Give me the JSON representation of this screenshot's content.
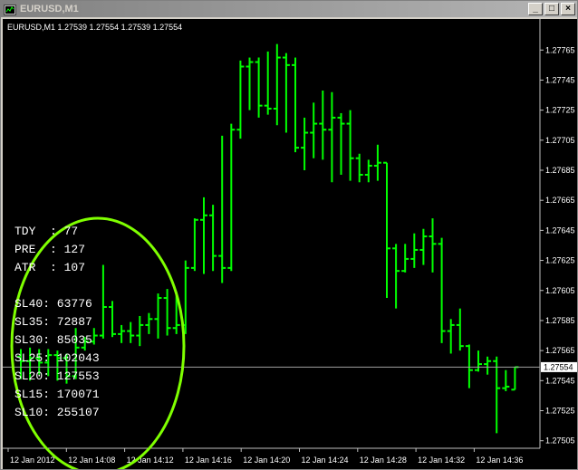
{
  "window": {
    "title": "EURUSD,M1",
    "minimize_glyph": "_",
    "maximize_glyph": "□",
    "close_glyph": "×"
  },
  "chart": {
    "header": "EURUSD,M1  1.27539 1.27554 1.27539 1.27554",
    "current_price_label": "1.27554",
    "colors": {
      "background": "#000000",
      "bars": "#00ff00",
      "axis": "#c0c0c0",
      "ellipse": "#7fff00",
      "text": "#ffffff"
    }
  },
  "chart_data": {
    "type": "ohlc",
    "y_ticks": [
      "1.27765",
      "1.27745",
      "1.27725",
      "1.27705",
      "1.27685",
      "1.27665",
      "1.27645",
      "1.27625",
      "1.27605",
      "1.27585",
      "1.27565",
      "1.27545",
      "1.27525",
      "1.27505"
    ],
    "x_ticks": [
      "12 Jan 2012",
      "12 Jan 14:08",
      "12 Jan 14:12",
      "12 Jan 14:16",
      "12 Jan 14:20",
      "12 Jan 14:24",
      "12 Jan 14:28",
      "12 Jan 14:32",
      "12 Jan 14:36"
    ],
    "ylim": [
      1.275,
      1.27776
    ],
    "current_price": 1.27554,
    "bars": [
      {
        "o": 1.27561,
        "h": 1.27566,
        "l": 1.27546,
        "c": 1.27558
      },
      {
        "o": 1.27558,
        "h": 1.27567,
        "l": 1.27545,
        "c": 1.2756
      },
      {
        "o": 1.2756,
        "h": 1.27566,
        "l": 1.27549,
        "c": 1.27557
      },
      {
        "o": 1.27557,
        "h": 1.27566,
        "l": 1.27548,
        "c": 1.27562
      },
      {
        "o": 1.27562,
        "h": 1.27565,
        "l": 1.27545,
        "c": 1.2756
      },
      {
        "o": 1.2756,
        "h": 1.27563,
        "l": 1.27543,
        "c": 1.27548
      },
      {
        "o": 1.27548,
        "h": 1.2758,
        "l": 1.27546,
        "c": 1.27567
      },
      {
        "o": 1.27567,
        "h": 1.27574,
        "l": 1.27565,
        "c": 1.27571
      },
      {
        "o": 1.27571,
        "h": 1.2758,
        "l": 1.27569,
        "c": 1.27575
      },
      {
        "o": 1.27575,
        "h": 1.27622,
        "l": 1.27573,
        "c": 1.27594
      },
      {
        "o": 1.27594,
        "h": 1.27598,
        "l": 1.27574,
        "c": 1.27576
      },
      {
        "o": 1.27576,
        "h": 1.27582,
        "l": 1.2757,
        "c": 1.27578
      },
      {
        "o": 1.27578,
        "h": 1.27584,
        "l": 1.2757,
        "c": 1.27575
      },
      {
        "o": 1.27575,
        "h": 1.27588,
        "l": 1.27568,
        "c": 1.27582
      },
      {
        "o": 1.27582,
        "h": 1.2759,
        "l": 1.27576,
        "c": 1.27586
      },
      {
        "o": 1.27586,
        "h": 1.27603,
        "l": 1.27573,
        "c": 1.276
      },
      {
        "o": 1.276,
        "h": 1.27606,
        "l": 1.27575,
        "c": 1.2758
      },
      {
        "o": 1.2758,
        "h": 1.27604,
        "l": 1.27576,
        "c": 1.27582
      },
      {
        "o": 1.27582,
        "h": 1.27625,
        "l": 1.27576,
        "c": 1.2762
      },
      {
        "o": 1.2762,
        "h": 1.27653,
        "l": 1.27618,
        "c": 1.27652
      },
      {
        "o": 1.27652,
        "h": 1.27667,
        "l": 1.27616,
        "c": 1.27655
      },
      {
        "o": 1.27655,
        "h": 1.27662,
        "l": 1.27618,
        "c": 1.27628
      },
      {
        "o": 1.27628,
        "h": 1.27708,
        "l": 1.2761,
        "c": 1.2762
      },
      {
        "o": 1.2762,
        "h": 1.27716,
        "l": 1.27618,
        "c": 1.27712
      },
      {
        "o": 1.27712,
        "h": 1.27758,
        "l": 1.27706,
        "c": 1.27754
      },
      {
        "o": 1.27754,
        "h": 1.2776,
        "l": 1.27725,
        "c": 1.27757
      },
      {
        "o": 1.27757,
        "h": 1.2776,
        "l": 1.2772,
        "c": 1.27728
      },
      {
        "o": 1.27728,
        "h": 1.27764,
        "l": 1.27722,
        "c": 1.27726
      },
      {
        "o": 1.27726,
        "h": 1.27769,
        "l": 1.27715,
        "c": 1.2776
      },
      {
        "o": 1.2776,
        "h": 1.27763,
        "l": 1.2771,
        "c": 1.27755
      },
      {
        "o": 1.27755,
        "h": 1.2776,
        "l": 1.27697,
        "c": 1.277
      },
      {
        "o": 1.277,
        "h": 1.2772,
        "l": 1.27685,
        "c": 1.2771
      },
      {
        "o": 1.2771,
        "h": 1.2773,
        "l": 1.27693,
        "c": 1.27716
      },
      {
        "o": 1.27716,
        "h": 1.27738,
        "l": 1.27692,
        "c": 1.27712
      },
      {
        "o": 1.27712,
        "h": 1.27737,
        "l": 1.27677,
        "c": 1.2772
      },
      {
        "o": 1.2772,
        "h": 1.27723,
        "l": 1.27682,
        "c": 1.27716
      },
      {
        "o": 1.27716,
        "h": 1.27725,
        "l": 1.27678,
        "c": 1.27693
      },
      {
        "o": 1.27693,
        "h": 1.27696,
        "l": 1.27677,
        "c": 1.27682
      },
      {
        "o": 1.27682,
        "h": 1.27692,
        "l": 1.27677,
        "c": 1.27688
      },
      {
        "o": 1.27688,
        "h": 1.27702,
        "l": 1.27678,
        "c": 1.2769
      },
      {
        "o": 1.2769,
        "h": 1.2769,
        "l": 1.276,
        "c": 1.27633
      },
      {
        "o": 1.27633,
        "h": 1.27636,
        "l": 1.27593,
        "c": 1.27618
      },
      {
        "o": 1.27618,
        "h": 1.27636,
        "l": 1.27617,
        "c": 1.27626
      },
      {
        "o": 1.27626,
        "h": 1.27643,
        "l": 1.2762,
        "c": 1.27632
      },
      {
        "o": 1.27632,
        "h": 1.27646,
        "l": 1.27622,
        "c": 1.27641
      },
      {
        "o": 1.27641,
        "h": 1.27653,
        "l": 1.27617,
        "c": 1.27636
      },
      {
        "o": 1.27636,
        "h": 1.2764,
        "l": 1.2757,
        "c": 1.27578
      },
      {
        "o": 1.27578,
        "h": 1.27586,
        "l": 1.27563,
        "c": 1.27582
      },
      {
        "o": 1.27582,
        "h": 1.27593,
        "l": 1.27565,
        "c": 1.27568
      },
      {
        "o": 1.27568,
        "h": 1.27569,
        "l": 1.2754,
        "c": 1.27552
      },
      {
        "o": 1.27552,
        "h": 1.27565,
        "l": 1.27551,
        "c": 1.27556
      },
      {
        "o": 1.27556,
        "h": 1.27561,
        "l": 1.27549,
        "c": 1.27558
      },
      {
        "o": 1.27558,
        "h": 1.27561,
        "l": 1.2751,
        "c": 1.2754
      },
      {
        "o": 1.2754,
        "h": 1.27552,
        "l": 1.27538,
        "c": 1.27541
      },
      {
        "o": 1.27539,
        "h": 1.27554,
        "l": 1.27539,
        "c": 1.27554
      }
    ]
  },
  "indicator": {
    "lines": [
      "TDY  : 77",
      "PRE  : 127",
      "ATR  : 107",
      "",
      "SL40: 63776",
      "SL35: 72887",
      "SL30: 85035",
      "SL25: 102043",
      "SL20: 127553",
      "SL15: 170071",
      "SL10: 255107"
    ]
  }
}
